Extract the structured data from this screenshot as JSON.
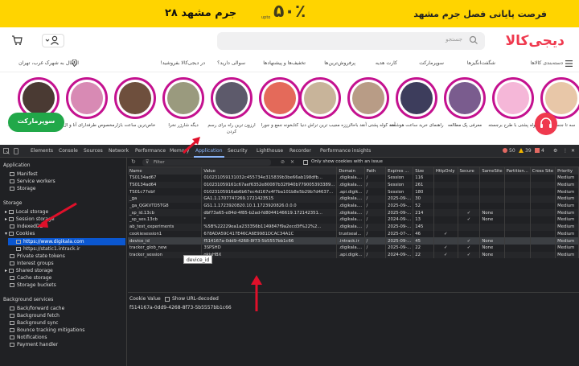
{
  "banner": {
    "promo_text": "فرصت پایانی فصل جرم مشهد",
    "brand_text": "۲۸ جرم مشهد",
    "badge_text": "۵۰٪",
    "badge_small": "upto"
  },
  "header": {
    "logo": "دیجی‌کالا",
    "search_placeholder": "جستجو"
  },
  "nav": {
    "categories": "دسته‌بندی کالاها",
    "items": [
      "شگفت‌انگیزها",
      "سوپرمارکت",
      "کارت هدیه",
      "پرفروش‌ترین‌ها",
      "تخفیف‌ها و پیشنهادها",
      "سوالی دارید؟",
      "در دیجی‌کالا بفروشید!"
    ],
    "location": "ارسال به شهرک غرب، تهران"
  },
  "stories": [
    {
      "label": "سه تا جنس از کاهش!"
    },
    {
      "label": "کوله پشتی با طرح برجسته"
    },
    {
      "label": "معرفی پک مطالعه"
    },
    {
      "label": "راهنمای خرید ساعت هوشمند"
    },
    {
      "label": "آخه کوله پشتی آنقد باحالزززه"
    },
    {
      "label": "مجیب ترین تراش دنیا"
    },
    {
      "label": "کتابخونه جمع و جورا"
    },
    {
      "label": "ارزون ترین راه برای رسم کردن"
    },
    {
      "label": "دیگه شارژر نخرا"
    },
    {
      "label": "خاص‌ترین ساعت بازار"
    },
    {
      "label": "مخصوص طرفدارای آنا و ال..."
    },
    {
      "label": "هی چی دیدی..."
    }
  ],
  "super_button": "سوپرمارکت",
  "devtools": {
    "tabs": [
      "Elements",
      "Console",
      "Sources",
      "Network",
      "Performance",
      "Memory",
      "Application",
      "Security",
      "Lighthouse",
      "Recorder",
      "Performance insights"
    ],
    "active_tab": "Application",
    "errors": "50",
    "warnings": "39",
    "info": "4",
    "sidebar": {
      "application_header": "Application",
      "application_items": [
        "Manifest",
        "Service workers",
        "Storage"
      ],
      "storage_header": "Storage",
      "storage_items": [
        "Local storage",
        "Session storage",
        "IndexedDB",
        "Cookies"
      ],
      "cookie_items": [
        "https://www.digikala.com",
        "https://static1.intrack.ir"
      ],
      "storage_items2": [
        "Private state tokens",
        "Interest groups",
        "Shared storage",
        "Cache storage",
        "Storage buckets"
      ],
      "background_header": "Background services",
      "background_items": [
        "Back/forward cache",
        "Background fetch",
        "Background sync",
        "Bounce tracking mitigations",
        "Notifications",
        "Payment handler"
      ]
    },
    "filter_placeholder": "Filter",
    "only_issue_label": "Only show cookies with an issue",
    "columns": [
      "Name",
      "Value",
      "Domain",
      "Path",
      "Expires ...",
      "Size",
      "HttpOnly",
      "Secure",
      "SameSite",
      "Partition...",
      "Cross Site",
      "Priority"
    ],
    "rows": [
      [
        "TS0134ad67",
        "010231059131032c455734e315839b3be66ab198dfb...",
        ".digikala....",
        "/",
        "Session",
        "116",
        "",
        "",
        "",
        "",
        "",
        "Medium"
      ],
      [
        "TS0134ad64",
        "010231059161c67aef6352e80087b32f940b779005393389...",
        ".digikala....",
        "/",
        "Session",
        "261",
        "",
        "",
        "",
        "",
        "",
        "Medium"
      ],
      [
        "TS01c77ebf",
        "01023105916ab6b67ec4d167e4f7ba101b8e5b29b7d4637...",
        ".api.digik...",
        "/",
        "Session",
        "180",
        "",
        "",
        "",
        "",
        "",
        "Medium"
      ],
      [
        "_ga",
        "GA1.1.1707747269.1721423515",
        ".digikala....",
        "/",
        "2025-09-...",
        "30",
        "",
        "",
        "",
        "",
        "",
        "Medium"
      ],
      [
        "_ga_QGKVTD5TG8",
        "GS1.1.1723920820.10.1.1723920826.0.0.0",
        ".digikala....",
        "/",
        "2025-09-...",
        "52",
        "",
        "",
        "",
        "",
        "",
        "Medium"
      ],
      [
        "_sp_id.13cb",
        "dbf73a65-e84d-4f85-b2ad-fd8044146619.172142351...",
        ".digikala....",
        "/",
        "2025-09-...",
        "214",
        "",
        "✓",
        "None",
        "",
        "",
        "Medium"
      ],
      [
        "_sp_ses.13cb",
        "*",
        ".digikala....",
        "/",
        "2024-09-...",
        "13",
        "",
        "✓",
        "None",
        "",
        "",
        "Medium"
      ],
      [
        "ab_test_experiments",
        "%5B%22229ea1a233356b1149847f9a2ecd3f%22%2...",
        ".digikala....",
        "/",
        "2025-09-...",
        "145",
        "",
        "",
        "",
        "",
        "",
        "Medium"
      ],
      [
        "cookiesession1",
        "678ADA59C417E46CA6E9981DCAC34A1C",
        "trustseal...",
        "/",
        "2025-07-...",
        "46",
        "✓",
        "",
        "",
        "",
        "",
        "Medium"
      ],
      [
        "device_id",
        "f514167a-0dd9-4268-8f73-5b5557bb1c66",
        ".intrack.ir",
        "/",
        "2025-09-...",
        "45",
        "",
        "✓",
        "None",
        "",
        "",
        "Medium"
      ],
      [
        "tracker_glob_new",
        "3SPSHD",
        ".digikala....",
        "/",
        "2025-09-...",
        "22",
        "✓",
        "✓",
        "None",
        "",
        "",
        "Medium"
      ],
      [
        "tracker_session",
        "gkisHBX",
        ".api.digik...",
        "/",
        "2024-09-...",
        "22",
        "✓",
        "✓",
        "None",
        "",
        "",
        "Medium"
      ]
    ],
    "tooltip": "device_id",
    "cookie_value_label": "Cookie Value",
    "show_url_decoded": "Show URL-decoded",
    "cookie_value": "f514167a-0dd9-4268-8f73-5b5557bb1c66"
  },
  "colors": {
    "brand": "#ef394e",
    "banner": "#ffd400",
    "story_ring": "#c4118f",
    "super_green": "#21a849",
    "devtools_bg": "#202124",
    "selection": "#0b57d0",
    "arrow": "#e0102a"
  }
}
